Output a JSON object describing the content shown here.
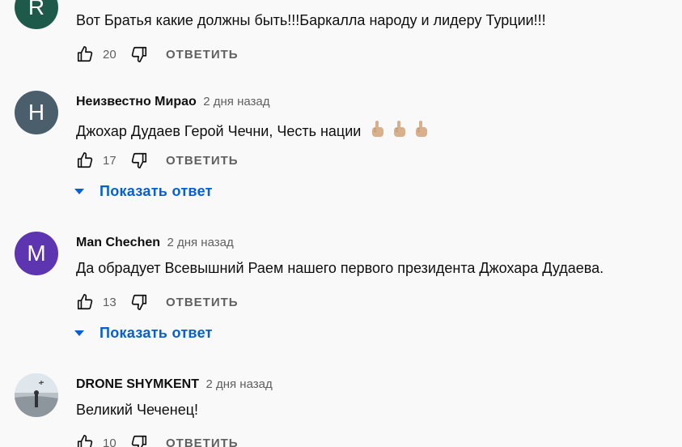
{
  "comments": [
    {
      "avatar_letter": "R",
      "avatar_color": "#1e5a4a",
      "author": "",
      "time": "",
      "text": "Вот Братья какие должны быть!!!Баркалла народу и лидеру Турции!!!",
      "likes": "20",
      "reply_label": "ОТВЕТИТЬ"
    },
    {
      "avatar_letter": "Н",
      "avatar_color": "#4a5e6b",
      "author": "Неизвестно Мирао",
      "time": "2 дня назад",
      "text": "Джохар Дудаев Герой Чечни, Честь нации",
      "emoji": "index-pointing-up-emoji",
      "likes": "17",
      "reply_label": "ОТВЕТИТЬ",
      "show_replies": "Показать ответ"
    },
    {
      "avatar_letter": "M",
      "avatar_color": "#5e35b1",
      "author": "Man Chechen",
      "time": "2 дня назад",
      "text": "Да обрадует Всевышний Раем нашего первого президента Джохара Дудаева.",
      "likes": "13",
      "reply_label": "ОТВЕТИТЬ",
      "show_replies": "Показать ответ"
    },
    {
      "avatar_letter": "",
      "avatar_color": "#c9d4dc",
      "author": "DRONE SHYMKENT",
      "time": "2 дня назад",
      "text": "Великий Чеченец!",
      "likes": "10",
      "reply_label": "ОТВЕТИТЬ"
    }
  ]
}
